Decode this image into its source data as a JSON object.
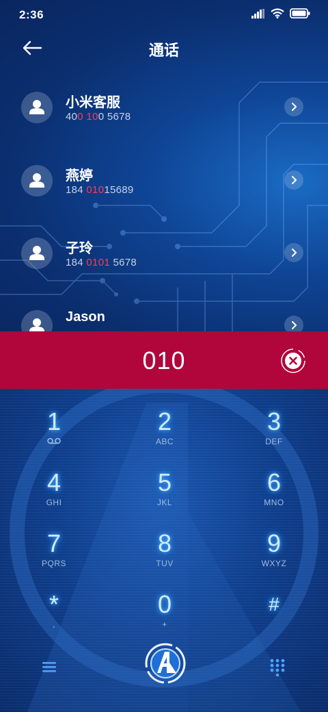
{
  "status_bar": {
    "time": "2:36"
  },
  "header": {
    "title": "通话",
    "back_icon": "arrow-left-icon"
  },
  "contacts": [
    {
      "name": "小米客服",
      "number_parts": [
        "40",
        "0",
        " ",
        "10",
        "0 5678"
      ]
    },
    {
      "name": "燕婷",
      "number_parts": [
        "184 ",
        "010",
        "15689"
      ]
    },
    {
      "name": "子玲",
      "number_parts": [
        "184 ",
        "0101",
        " 5678"
      ]
    },
    {
      "name": "Jason",
      "number_parts": []
    }
  ],
  "input": {
    "value": "010",
    "clear_icon": "clear-icon"
  },
  "keypad": [
    {
      "digit": "1",
      "letters": "voicemail-icon"
    },
    {
      "digit": "2",
      "letters": "ABC"
    },
    {
      "digit": "3",
      "letters": "DEF"
    },
    {
      "digit": "4",
      "letters": "GHI"
    },
    {
      "digit": "5",
      "letters": "JKL"
    },
    {
      "digit": "6",
      "letters": "MNO"
    },
    {
      "digit": "7",
      "letters": "PQRS"
    },
    {
      "digit": "8",
      "letters": "TUV"
    },
    {
      "digit": "9",
      "letters": "WXYZ"
    },
    {
      "digit": "*",
      "letters": ","
    },
    {
      "digit": "0",
      "letters": "+"
    },
    {
      "digit": "#",
      "letters": ""
    }
  ],
  "bottom": {
    "menu_icon": "menu-icon",
    "dial_icon": "avengers-dial-icon",
    "keypad_icon": "keypad-grid-icon"
  },
  "colors": {
    "accent_red": "#b0063b",
    "highlight": "#ff3b55",
    "background": "#0b2f6e",
    "glow": "#49b4ff"
  }
}
